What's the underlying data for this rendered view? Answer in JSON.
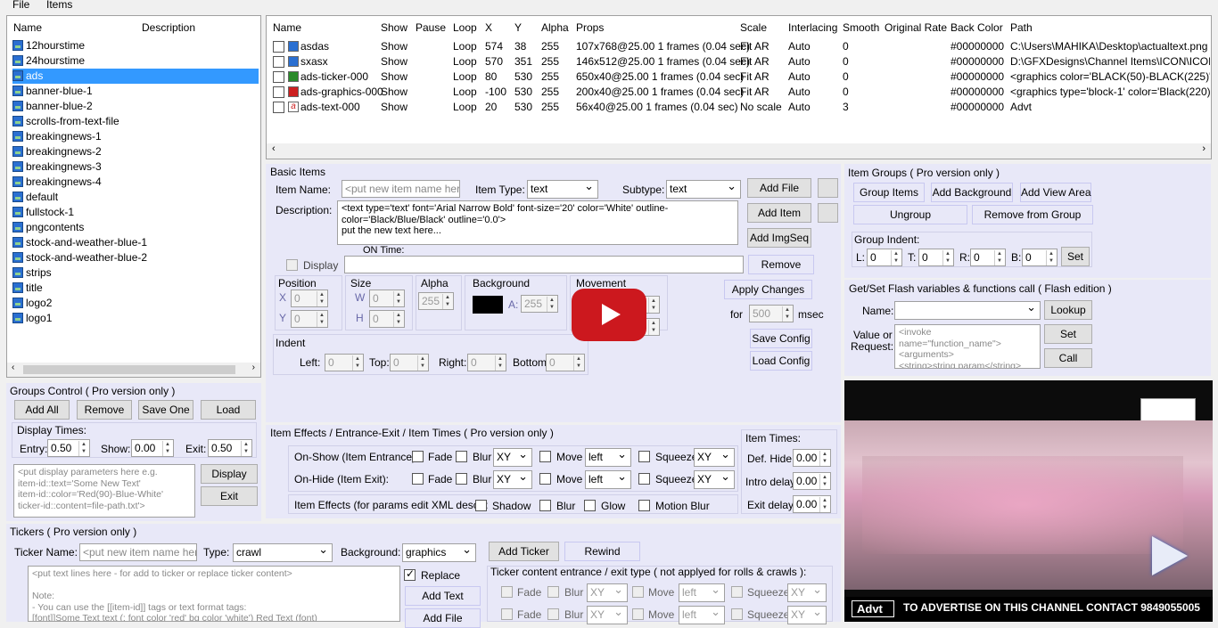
{
  "menu": {
    "file": "File",
    "items": "Items"
  },
  "tree": {
    "col_name": "Name",
    "col_desc": "Description",
    "items": [
      "12hourstime",
      "24hourstime",
      "ads",
      "banner-blue-1",
      "banner-blue-2",
      "scrolls-from-text-file",
      "breakingnews-1",
      "breakingnews-2",
      "breakingnews-3",
      "breakingnews-4",
      "default",
      "fullstock-1",
      "pngcontents",
      "stock-and-weather-blue-1",
      "stock-and-weather-blue-2",
      "strips",
      "title",
      "logo2",
      "logo1"
    ],
    "selected": "ads"
  },
  "grid": {
    "headers": {
      "name": "Name",
      "show": "Show",
      "pause": "Pause",
      "loop": "Loop",
      "x": "X",
      "y": "Y",
      "alpha": "Alpha",
      "props": "Props",
      "scale": "Scale",
      "interlacing": "Interlacing",
      "smooth": "Smooth",
      "orig": "Original Rate",
      "back": "Back Color",
      "path": "Path"
    },
    "rows": [
      {
        "name": "asdas",
        "show": "Show",
        "loop": "Loop",
        "x": "574",
        "y": "38",
        "alpha": "255",
        "props": "107x768@25.00 1 frames (0.04 sec)",
        "scale": "Fit AR",
        "inter": "Auto",
        "smooth": "0",
        "back": "#00000000",
        "path": "C:\\Users\\MAHIKA\\Desktop\\actualtext.png",
        "icon": "image"
      },
      {
        "name": "sxasx",
        "show": "Show",
        "loop": "Loop",
        "x": "570",
        "y": "351",
        "alpha": "255",
        "props": "146x512@25.00 1 frames (0.04 sec)",
        "scale": "Fit AR",
        "inter": "Auto",
        "smooth": "0",
        "back": "#00000000",
        "path": "D:\\GFXDesigns\\Channel Items\\ICON\\ICON.PN",
        "icon": "image"
      },
      {
        "name": "ads-ticker-000",
        "show": "Show",
        "loop": "Loop",
        "x": "80",
        "y": "530",
        "alpha": "255",
        "props": "650x40@25.00 1 frames (0.04 sec)",
        "scale": "Fit AR",
        "inter": "Auto",
        "smooth": "0",
        "back": "#00000000",
        "path": "<graphics color='BLACK(50)-BLACK(225)'/>",
        "icon": "ticker"
      },
      {
        "name": "ads-graphics-000",
        "show": "Show",
        "loop": "Loop",
        "x": "-100",
        "y": "530",
        "alpha": "255",
        "props": "200x40@25.00 1 frames (0.04 sec)",
        "scale": "Fit AR",
        "inter": "Auto",
        "smooth": "0",
        "back": "#00000000",
        "path": "<graphics type='block-1' color='Black(220)' outlin",
        "icon": "graphics"
      },
      {
        "name": "ads-text-000",
        "show": "Show",
        "loop": "Loop",
        "x": "20",
        "y": "530",
        "alpha": "255",
        "props": "56x40@25.00 1 frames (0.04 sec)",
        "scale": "No scale",
        "inter": "Auto",
        "smooth": "3",
        "back": "#00000000",
        "path": "Advt",
        "icon": "text"
      }
    ]
  },
  "basic": {
    "title": "Basic Items",
    "item_name_label": "Item Name:",
    "item_name_ph": "<put new item name here>",
    "item_type_label": "Item Type:",
    "item_type": "text",
    "subtype_label": "Subtype:",
    "subtype": "text",
    "desc_label": "Description:",
    "desc_text": "<text type='text' font='Arial Narrow Bold' font-size='20' color='White' outline-color='Black/Blue/Black' outline='0.0'>\nput the new text here...",
    "on_time": "ON Time:",
    "display": "Display",
    "position": "Position",
    "size": "Size",
    "alpha": "Alpha",
    "background": "Background",
    "movement": "Movement",
    "x": "X",
    "y": "Y",
    "w": "W",
    "h": "H",
    "a": "A:",
    "zero": "0",
    "a255": "255",
    "indent": "Indent",
    "left": "Left:",
    "top": "Top:",
    "right": "Right:",
    "bottom": "Bottom:",
    "for": "for",
    "for_val": "500",
    "msec": "msec",
    "add_file": "Add File",
    "add_item": "Add Item",
    "add_imgseq": "Add ImgSeq",
    "remove": "Remove",
    "apply": "Apply Changes",
    "save_cfg": "Save Config",
    "load_cfg": "Load Config"
  },
  "groups_ctrl": {
    "title": "Groups Control ( Pro version only )",
    "add_all": "Add All",
    "remove": "Remove",
    "save_one": "Save One",
    "load": "Load",
    "display_times": "Display Times:",
    "entry": "Entry:",
    "entry_val": "0.50",
    "show": "Show:",
    "show_val": "0.00",
    "exit": "Exit:",
    "exit_val": "0.50",
    "params_ph": "<put display parameters here e.g.\nitem-id::text='Some New Text'\nitem-id::color='Red(90)-Blue-White'\nticker-id::content=file-path.txt'>",
    "display_btn": "Display",
    "exit_btn": "Exit"
  },
  "effects": {
    "title": "Item Effects / Entrance-Exit / Item Times ( Pro version only )",
    "on_show": "On-Show (Item Entrance):",
    "on_hide": "On-Hide (Item Exit):",
    "fade": "Fade",
    "blur": "Blur",
    "xy": "XY",
    "move": "Move",
    "left": "left",
    "squeeze": "Squeeze",
    "item_effects": "Item Effects (for params edit XML desc ):",
    "shadow": "Shadow",
    "glow": "Glow",
    "motion_blur": "Motion Blur",
    "item_times": "Item Times:",
    "def_hide": "Def. Hide:",
    "intro_delay": "Intro delay:",
    "exit_delay": "Exit delay:",
    "t0": "0.00"
  },
  "item_groups": {
    "title": "Item Groups ( Pro version only )",
    "group_items": "Group Items",
    "add_bg": "Add Background",
    "add_view": "Add View Area",
    "ungroup": "Ungroup",
    "remove_from": "Remove from Group",
    "indent": "Group Indent:",
    "l": "L:",
    "t": "T:",
    "r": "R:",
    "b": "B:",
    "zero": "0",
    "set": "Set"
  },
  "flash": {
    "title": "Get/Set Flash variables & functions call ( Flash edition )",
    "name": "Name:",
    "lookup": "Lookup",
    "value_or": "Value or",
    "request": "Request:",
    "req_ph": "<invoke name=\"function_name\">\n<arguments>\n<string>string param</string>",
    "set": "Set",
    "call": "Call"
  },
  "tickers": {
    "title": "Tickers ( Pro version only )",
    "name_label": "Ticker Name:",
    "name_ph": "<put new item name here>",
    "type_label": "Type:",
    "type_val": "crawl",
    "bg_label": "Background:",
    "bg_val": "graphics",
    "add_ticker": "Add Ticker",
    "rewind": "Rewind",
    "content_ph": "<put text lines here - for add to ticker or replace ticker content>\n\nNote:\n- You can use the [[item-id]] tags or text format tags:\n[font]]Some Text text (: font color 'red' bg color 'white') Red Text (font)",
    "replace": "Replace",
    "add_text": "Add Text",
    "add_file": "Add File",
    "entrance_title": "Ticker content entrance / exit type ( not applyed for rolls & crawls ):",
    "fade": "Fade",
    "blur": "Blur",
    "xy": "XY",
    "move": "Move",
    "left": "left",
    "squeeze": "Squeeze"
  },
  "preview": {
    "ticker_label": "Advt",
    "ticker_text": "TO ADVERTISE ON THIS CHANNEL CONTACT 9849055005"
  },
  "colors": {
    "accent": "#3399ff",
    "group_bg": "#e8e8f8",
    "youtube": "#cc181e"
  }
}
